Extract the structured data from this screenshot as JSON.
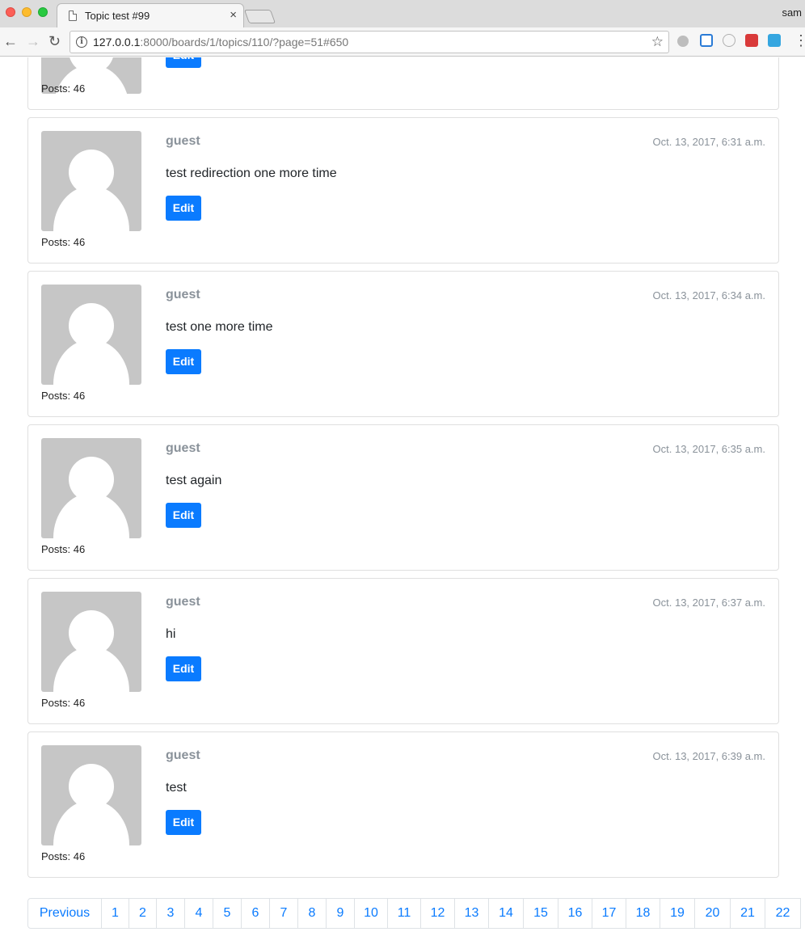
{
  "browser": {
    "tab_title": "Topic test #99",
    "tab_close": "×",
    "profile_name": "sam",
    "url_host": "127.0.0.1",
    "url_rest": ":8000/boards/1/topics/110/?page=51#650",
    "icons": {
      "back": "arrow-left-icon",
      "forward": "arrow-right-icon",
      "reload": "reload-icon",
      "info": "info-icon",
      "bookmark": "star-icon",
      "menu": "menu-dots-icon"
    }
  },
  "partial_post": {
    "posts_count": "Posts: 46",
    "edit_label": "Edit"
  },
  "posts": [
    {
      "author": "guest",
      "date": "Oct. 13, 2017, 6:31 a.m.",
      "message": "test redirection one more time",
      "posts_count": "Posts: 46",
      "edit_label": "Edit"
    },
    {
      "author": "guest",
      "date": "Oct. 13, 2017, 6:34 a.m.",
      "message": "test one more time",
      "posts_count": "Posts: 46",
      "edit_label": "Edit"
    },
    {
      "author": "guest",
      "date": "Oct. 13, 2017, 6:35 a.m.",
      "message": "test again",
      "posts_count": "Posts: 46",
      "edit_label": "Edit"
    },
    {
      "author": "guest",
      "date": "Oct. 13, 2017, 6:37 a.m.",
      "message": "hi",
      "posts_count": "Posts: 46",
      "edit_label": "Edit"
    },
    {
      "author": "guest",
      "date": "Oct. 13, 2017, 6:39 a.m.",
      "message": "test",
      "posts_count": "Posts: 46",
      "edit_label": "Edit"
    }
  ],
  "pagination": {
    "previous_label": "Previous",
    "pages": [
      "1",
      "2",
      "3",
      "4",
      "5",
      "6",
      "7",
      "8",
      "9",
      "10",
      "11",
      "12",
      "13",
      "14",
      "15",
      "16",
      "17",
      "18",
      "19",
      "20",
      "21",
      "22"
    ]
  },
  "colors": {
    "primary": "#0a7bff",
    "muted": "#8a929a",
    "avatar_bg": "#c6c6c6"
  }
}
